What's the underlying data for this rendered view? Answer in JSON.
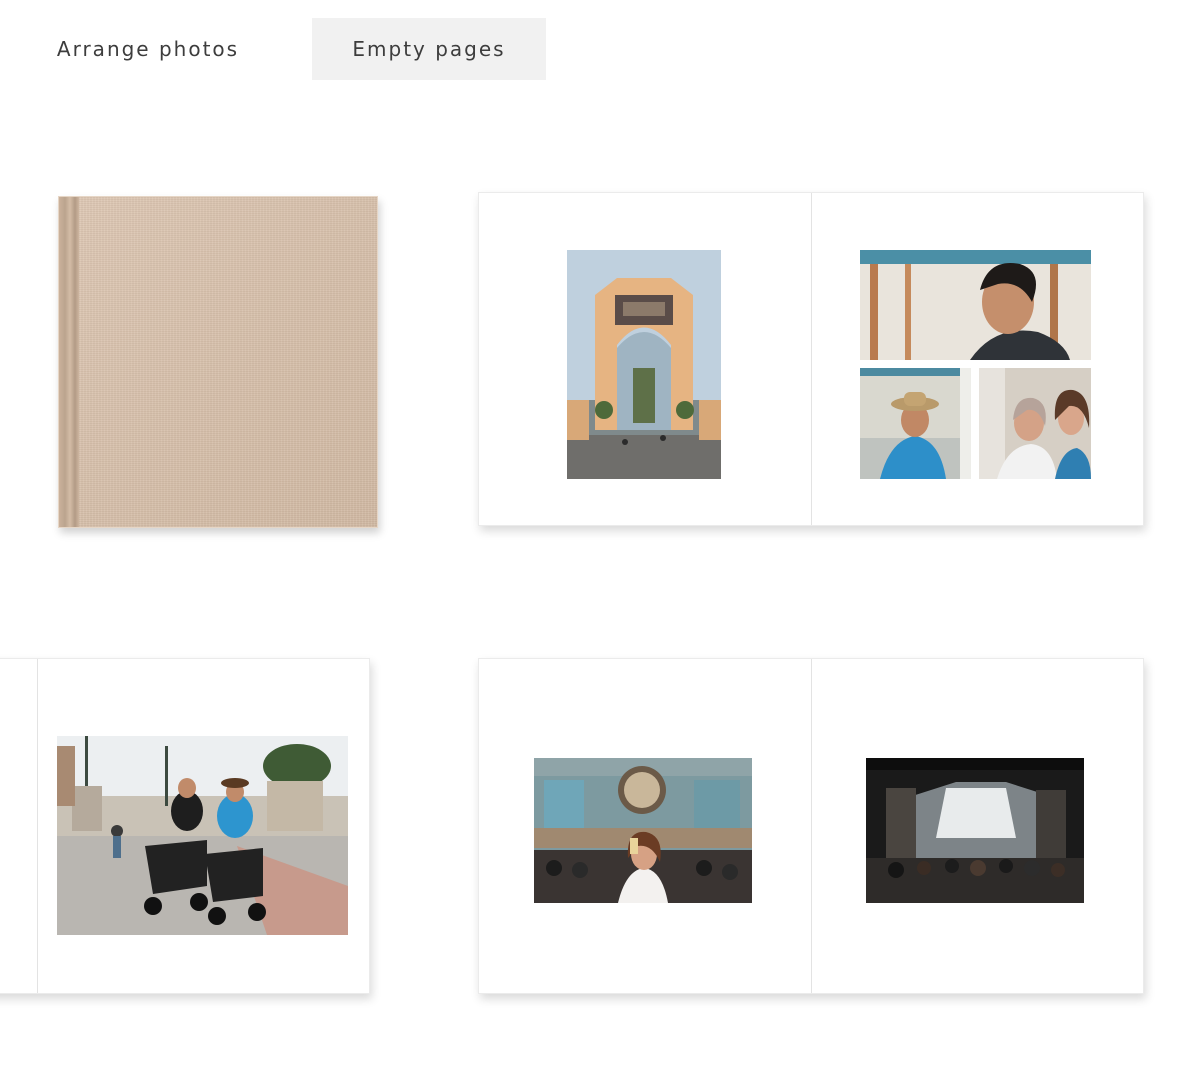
{
  "tabs": [
    {
      "label": "Arrange photos",
      "active": false
    },
    {
      "label": "Empty pages",
      "active": true
    }
  ],
  "cover": {
    "fabric_color": "#d6bfaa"
  },
  "spreads": [
    {
      "pages": [
        {
          "photos": [
            "archway-photo"
          ]
        },
        {
          "photos": [
            "man-portrait-photo",
            "man-in-hat-photo",
            "women-smiling-photo"
          ]
        }
      ]
    },
    {
      "pages": [
        {
          "photos": [
            "scooter-couple-photo"
          ]
        }
      ]
    },
    {
      "pages": [
        {
          "photos": [
            "woman-toast-photo"
          ]
        },
        {
          "photos": [
            "street-crowd-photo"
          ]
        }
      ]
    }
  ],
  "colors": {
    "active_tab_bg": "#f1f1f1",
    "text": "#3d3d3d"
  }
}
